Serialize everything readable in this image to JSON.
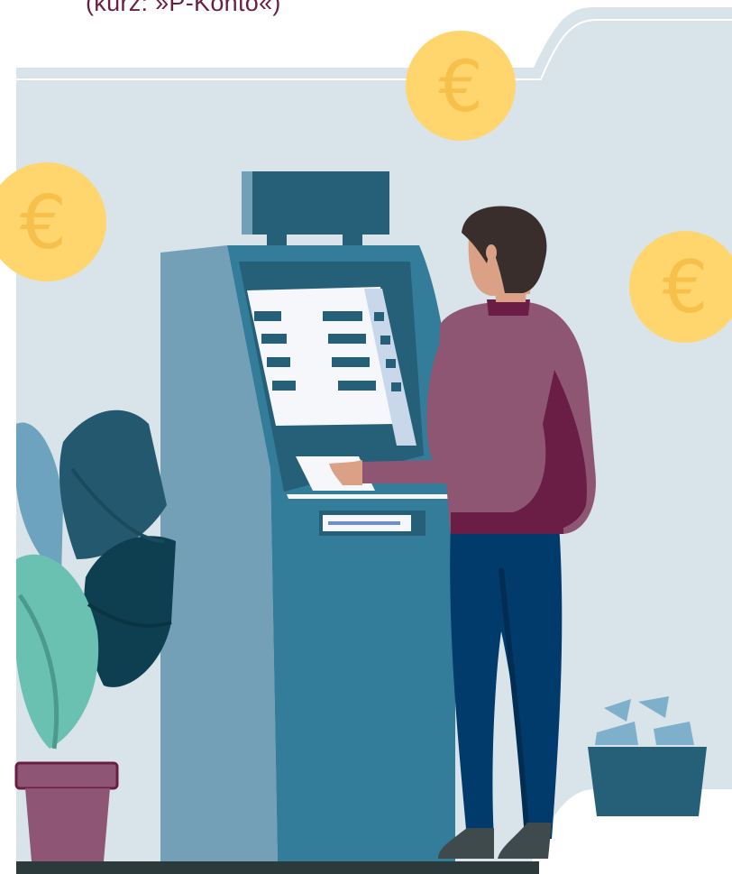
{
  "caption": {
    "text": "(kurz: »P-Konto«)"
  },
  "coins": {
    "symbol": "€"
  },
  "colors": {
    "background": "#d9e3ea",
    "coin": "#ffd56e",
    "coin_symbol": "#f7c04a",
    "atm_body": "#337d9b",
    "atm_side": "#74a0b7",
    "atm_dark": "#255f78",
    "shirt": "#8e5672",
    "collar": "#6b1e45",
    "jeans": "#003b6b",
    "hair": "#3a2e2d",
    "skin": "#dba186",
    "pot": "#8f5574",
    "floor": "#2c3a3c"
  }
}
